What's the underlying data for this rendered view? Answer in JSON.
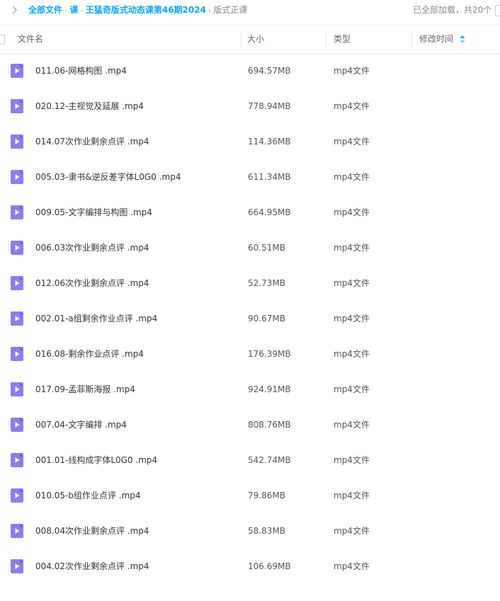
{
  "breadcrumb": {
    "items": [
      "全部文件",
      "课",
      "王猛奇版式动态课第46期2024"
    ],
    "current": "版式正课",
    "separator": "›",
    "load_status": "已全部加载，共20个"
  },
  "table": {
    "headers": {
      "name": "文件名",
      "size": "大小",
      "type": "类型",
      "modified": "修改时间"
    },
    "rows": [
      {
        "name": "011.06-网格构图 .mp4",
        "size": "694.57MB",
        "type": "mp4文件"
      },
      {
        "name": "020.12-主视觉及延展 .mp4",
        "size": "778.94MB",
        "type": "mp4文件"
      },
      {
        "name": "014.07次作业剩余点评 .mp4",
        "size": "114.36MB",
        "type": "mp4文件"
      },
      {
        "name": "005.03-隶书&逆反差字体L0G0 .mp4",
        "size": "611.34MB",
        "type": "mp4文件"
      },
      {
        "name": "009.05-文字编排与构图 .mp4",
        "size": "664.95MB",
        "type": "mp4文件"
      },
      {
        "name": "006.03次作业剩余点评 .mp4",
        "size": "60.51MB",
        "type": "mp4文件"
      },
      {
        "name": "012.06次作业剩余点评 .mp4",
        "size": "52.73MB",
        "type": "mp4文件"
      },
      {
        "name": "002.01-a组剩余作业点评 .mp4",
        "size": "90.67MB",
        "type": "mp4文件"
      },
      {
        "name": "016.08-剩余作业点评 .mp4",
        "size": "176.39MB",
        "type": "mp4文件"
      },
      {
        "name": "017.09-孟菲斯海报 .mp4",
        "size": "924.91MB",
        "type": "mp4文件"
      },
      {
        "name": "007.04-文字编排 .mp4",
        "size": "808.76MB",
        "type": "mp4文件"
      },
      {
        "name": "001.01-线构成字体L0G0 .mp4",
        "size": "542.74MB",
        "type": "mp4文件"
      },
      {
        "name": "010.05-b组作业点评 .mp4",
        "size": "79.86MB",
        "type": "mp4文件"
      },
      {
        "name": "008.04次作业剩余点评 .mp4",
        "size": "58.83MB",
        "type": "mp4文件"
      },
      {
        "name": "004.02次作业剩余点评 .mp4",
        "size": "106.69MB",
        "type": "mp4文件"
      }
    ]
  },
  "colors": {
    "accent": "#06a7ff",
    "file_icon": "#8c7cf0",
    "file_icon_dark": "#6f5ee0"
  },
  "icons": {
    "file": "video-file-icon",
    "back": "chevron-left-icon",
    "sort": "sort-icon"
  }
}
